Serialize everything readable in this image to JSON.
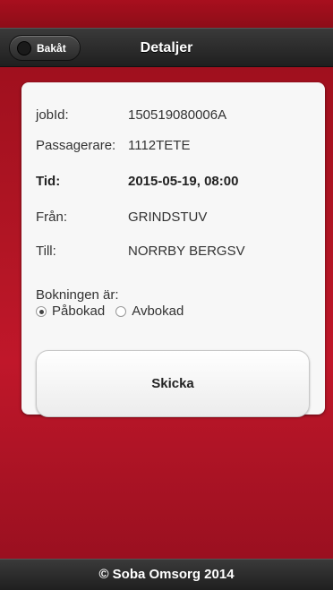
{
  "header": {
    "back_label": "Bakåt",
    "title": "Detaljer"
  },
  "details": [
    {
      "label": "jobId:",
      "value": "150519080006A"
    },
    {
      "label": "Passagerare:",
      "value": "1112TETE"
    },
    {
      "label": "Tid:",
      "value": "2015-05-19, 08:00"
    },
    {
      "label": "Från:",
      "value": "GRINDSTUV"
    },
    {
      "label": "Till:",
      "value": "NORRBY BERGSV"
    }
  ],
  "booking": {
    "label": "Bokningen är:",
    "options": [
      "Påbokad",
      "Avbokad"
    ],
    "selected": "Påbokad"
  },
  "send_label": "Skicka",
  "footer": "© Soba Omsorg 2014",
  "colors": {
    "background": "#b11524",
    "bar": "#2a2a2a",
    "card": "#f7f7f7"
  }
}
